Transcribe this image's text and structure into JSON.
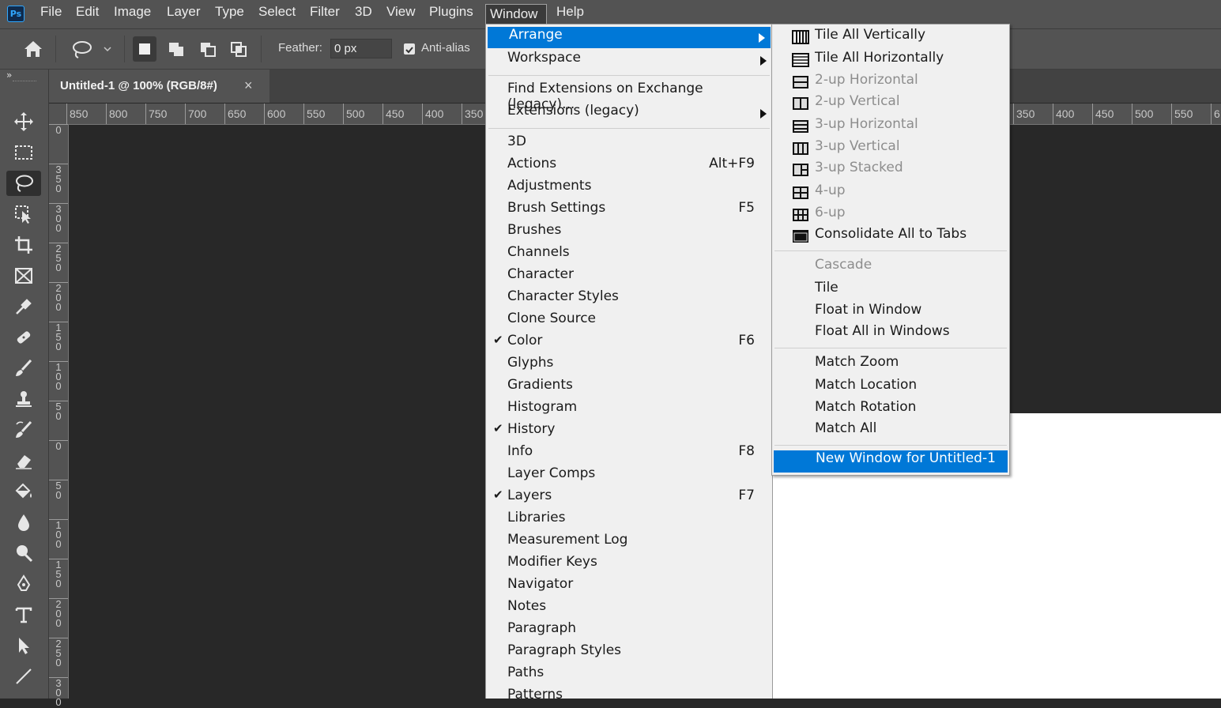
{
  "menubar": {
    "logo": "Ps",
    "items": [
      "File",
      "Edit",
      "Image",
      "Layer",
      "Type",
      "Select",
      "Filter",
      "3D",
      "View",
      "Plugins",
      "Window",
      "Help"
    ],
    "active": "Window"
  },
  "options_bar": {
    "feather_label": "Feather:",
    "feather_value": "0 px",
    "antialias_label": "Anti-alias",
    "antialias_checked": true
  },
  "document_tab": {
    "title": "Untitled-1 @ 100% (RGB/8#)",
    "close": "×"
  },
  "toolbar": {
    "collapse": "»",
    "tools": [
      "move-icon",
      "marquee-icon",
      "lasso-icon",
      "object-select-icon",
      "crop-icon",
      "frame-icon",
      "eyedropper-icon",
      "healing-icon",
      "brush-icon",
      "stamp-icon",
      "history-brush-icon",
      "eraser-icon",
      "paint-bucket-icon",
      "blur-icon",
      "dodge-icon",
      "pen-icon",
      "type-icon",
      "path-select-icon",
      "line-icon"
    ]
  },
  "rulers": {
    "top_left": [
      "850",
      "800",
      "750",
      "700",
      "650",
      "600",
      "550",
      "500",
      "450",
      "400",
      "350"
    ],
    "top_right": [
      "350",
      "400",
      "450",
      "500",
      "550",
      "6"
    ],
    "left": [
      "0",
      "350",
      "300",
      "250",
      "200",
      "150",
      "100",
      "50",
      "0",
      "50",
      "100",
      "150",
      "200",
      "250",
      "300"
    ]
  },
  "window_menu": {
    "items": [
      {
        "label": "Arrange",
        "submenu": true,
        "highlight": true
      },
      {
        "label": "Workspace",
        "submenu": true
      },
      {
        "sep": true
      },
      {
        "label": "Find Extensions on Exchange (legacy)..."
      },
      {
        "label": "Extensions (legacy)",
        "submenu": true
      },
      {
        "sep": true
      },
      {
        "label": "3D"
      },
      {
        "label": "Actions",
        "shortcut": "Alt+F9"
      },
      {
        "label": "Adjustments"
      },
      {
        "label": "Brush Settings",
        "shortcut": "F5"
      },
      {
        "label": "Brushes"
      },
      {
        "label": "Channels"
      },
      {
        "label": "Character"
      },
      {
        "label": "Character Styles"
      },
      {
        "label": "Clone Source"
      },
      {
        "label": "Color",
        "shortcut": "F6",
        "checked": true
      },
      {
        "label": "Glyphs"
      },
      {
        "label": "Gradients"
      },
      {
        "label": "Histogram"
      },
      {
        "label": "History",
        "checked": true
      },
      {
        "label": "Info",
        "shortcut": "F8"
      },
      {
        "label": "Layer Comps"
      },
      {
        "label": "Layers",
        "shortcut": "F7",
        "checked": true
      },
      {
        "label": "Libraries"
      },
      {
        "label": "Measurement Log"
      },
      {
        "label": "Modifier Keys"
      },
      {
        "label": "Navigator"
      },
      {
        "label": "Notes"
      },
      {
        "label": "Paragraph"
      },
      {
        "label": "Paragraph Styles"
      },
      {
        "label": "Paths"
      },
      {
        "label": "Patterns"
      }
    ]
  },
  "arrange_submenu": {
    "items": [
      {
        "label": "Tile All Vertically",
        "icon": "tile-vertical-icon"
      },
      {
        "label": "Tile All Horizontally",
        "icon": "tile-horizontal-icon"
      },
      {
        "label": "2-up Horizontal",
        "icon": "2up-horizontal-icon",
        "disabled": true
      },
      {
        "label": "2-up Vertical",
        "icon": "2up-vertical-icon",
        "disabled": true
      },
      {
        "label": "3-up Horizontal",
        "icon": "3up-horizontal-icon",
        "disabled": true
      },
      {
        "label": "3-up Vertical",
        "icon": "3up-vertical-icon",
        "disabled": true
      },
      {
        "label": "3-up Stacked",
        "icon": "3up-stacked-icon",
        "disabled": true
      },
      {
        "label": "4-up",
        "icon": "4up-icon",
        "disabled": true
      },
      {
        "label": "6-up",
        "icon": "6up-icon",
        "disabled": true
      },
      {
        "label": "Consolidate All to Tabs",
        "icon": "consolidate-icon"
      },
      {
        "sep": true
      },
      {
        "label": "Cascade",
        "disabled": true
      },
      {
        "label": "Tile"
      },
      {
        "label": "Float in Window"
      },
      {
        "label": "Float All in Windows"
      },
      {
        "sep": true
      },
      {
        "label": "Match Zoom"
      },
      {
        "label": "Match Location"
      },
      {
        "label": "Match Rotation"
      },
      {
        "label": "Match All"
      },
      {
        "sep": true
      },
      {
        "label": "New Window for Untitled-1",
        "highlight": true
      }
    ]
  },
  "colors": {
    "accent": "#0078d7",
    "menu_bg": "#f0f0f0",
    "ui_panel": "#535353",
    "canvas_bg": "#282828"
  }
}
